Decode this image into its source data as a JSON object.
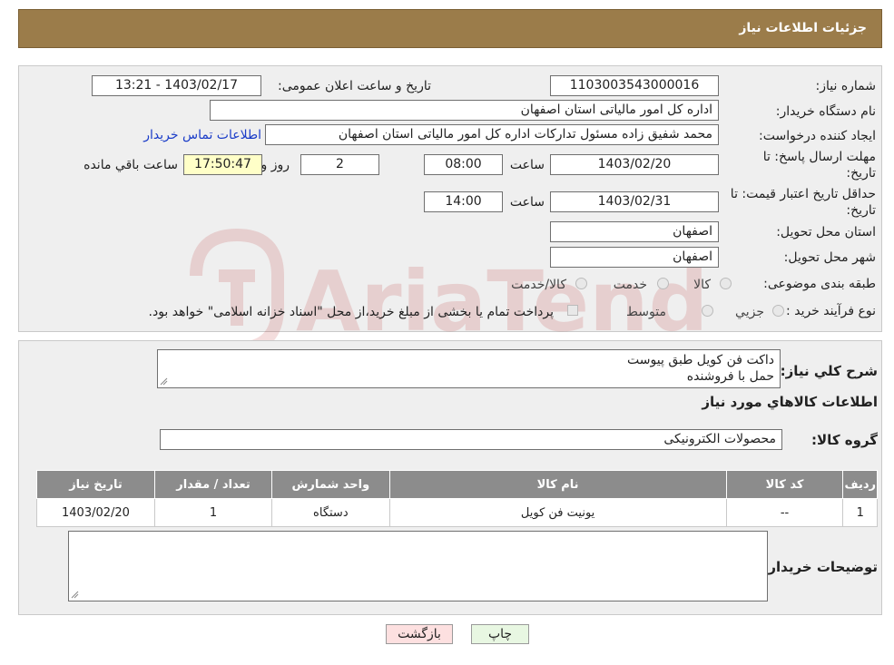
{
  "header": {
    "title": "جزئیات اطلاعات نیاز"
  },
  "form": {
    "need_number_label": "شماره نیاز:",
    "need_number": "1103003543000016",
    "announce_label": "تاریخ و ساعت اعلان عمومی:",
    "announce_value": "1403/02/17 - 13:21",
    "buyer_org_label": "نام دستگاه خریدار:",
    "buyer_org": "اداره کل امور مالیاتی استان اصفهان",
    "creator_label": "ایجاد کننده درخواست:",
    "creator": "محمد شفیق زاده مسئول تدارکات اداره کل امور مالیاتی استان اصفهان",
    "contact_link": "اطلاعات تماس خریدار",
    "deadline_label_1": "مهلت ارسال پاسخ: تا",
    "deadline_label_2": "تاریخ:",
    "deadline_date": "1403/02/20",
    "time_label": "ساعت",
    "deadline_time": "08:00",
    "days_value": "2",
    "days_label": "روز و",
    "remaining_time": "17:50:47",
    "remaining_label": "ساعت باقي مانده",
    "validity_label_1": "حداقل تاریخ اعتبار قیمت: تا",
    "validity_label_2": "تاریخ:",
    "validity_date": "1403/02/31",
    "validity_time_label": "ساعت",
    "validity_time": "14:00",
    "province_label": "استان محل تحویل:",
    "province": "اصفهان",
    "city_label": "شهر محل تحویل:",
    "city": "اصفهان",
    "category_label": "طبقه بندی موضوعی:",
    "category_options": [
      "کالا",
      "خدمت",
      "کالا/خدمت"
    ],
    "process_label": "نوع فرآیند خرید :",
    "process_options": [
      "جزیي",
      "متوسط"
    ],
    "process_note": "پرداخت تمام یا بخشی از مبلغ خرید،از محل \"اسناد خزانه اسلامی\" خواهد بود."
  },
  "details": {
    "description_label": "شرح کلي نياز:",
    "description_line1": "داکت فن کویل طبق پیوست",
    "description_line2": "حمل با فروشنده",
    "items_heading": "اطلاعات کالاهاي مورد نياز",
    "group_label": "گروه کالا:",
    "group_value": "محصولات الکترونیکی",
    "table": {
      "headers": [
        "رديف",
        "کد کالا",
        "نام کالا",
        "واحد شمارش",
        "تعداد / مقدار",
        "تاریخ نیاز"
      ],
      "rows": [
        [
          "1",
          "--",
          "یونیت فن کویل",
          "دستگاه",
          "1",
          "1403/02/20"
        ]
      ]
    },
    "buyer_notes_label": "توضیحات خریدار:"
  },
  "buttons": {
    "print": "چاپ",
    "back": "بازگشت"
  },
  "watermark": {
    "text": "AriaTender.neT"
  }
}
